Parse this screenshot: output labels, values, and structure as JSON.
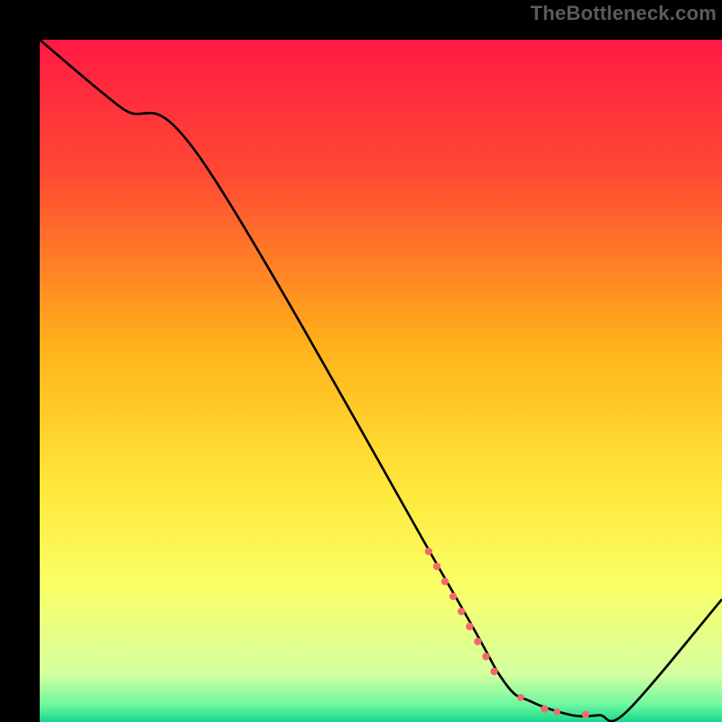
{
  "watermark": "TheBottleneck.com",
  "chart_data": {
    "type": "line",
    "title": "",
    "xlabel": "",
    "ylabel": "",
    "xlim": [
      0,
      100
    ],
    "ylim": [
      0,
      100
    ],
    "grid": false,
    "background_gradient": {
      "stops": [
        {
          "pos": 0.0,
          "color": "#ff1a44"
        },
        {
          "pos": 0.2,
          "color": "#ff4a33"
        },
        {
          "pos": 0.45,
          "color": "#ffb21a"
        },
        {
          "pos": 0.65,
          "color": "#ffe63a"
        },
        {
          "pos": 0.8,
          "color": "#faff66"
        },
        {
          "pos": 0.93,
          "color": "#d4ffa0"
        },
        {
          "pos": 0.975,
          "color": "#6cf7a0"
        },
        {
          "pos": 1.0,
          "color": "#15d98a"
        }
      ]
    },
    "series": [
      {
        "name": "bottleneck-curve",
        "color": "#000000",
        "x": [
          0,
          12,
          24,
          60,
          68,
          72,
          78,
          82,
          86,
          100
        ],
        "y": [
          100,
          90,
          82,
          20,
          6,
          3,
          1,
          1,
          1.5,
          18
        ]
      }
    ],
    "markers": {
      "name": "highlight-dots",
      "color": "#ef6b6b",
      "points": [
        {
          "x": 57.0,
          "y": 25.0,
          "r": 0.55
        },
        {
          "x": 58.2,
          "y": 22.8,
          "r": 0.55
        },
        {
          "x": 59.4,
          "y": 20.6,
          "r": 0.55
        },
        {
          "x": 60.6,
          "y": 18.4,
          "r": 0.55
        },
        {
          "x": 61.8,
          "y": 16.2,
          "r": 0.55
        },
        {
          "x": 63.0,
          "y": 14.0,
          "r": 0.55
        },
        {
          "x": 64.2,
          "y": 11.8,
          "r": 0.55
        },
        {
          "x": 65.4,
          "y": 9.6,
          "r": 0.55
        },
        {
          "x": 66.6,
          "y": 7.4,
          "r": 0.55
        },
        {
          "x": 70.5,
          "y": 3.6,
          "r": 0.5
        },
        {
          "x": 74.0,
          "y": 1.9,
          "r": 0.55
        },
        {
          "x": 75.8,
          "y": 1.5,
          "r": 0.5
        },
        {
          "x": 80.0,
          "y": 1.1,
          "r": 0.55
        }
      ]
    }
  }
}
